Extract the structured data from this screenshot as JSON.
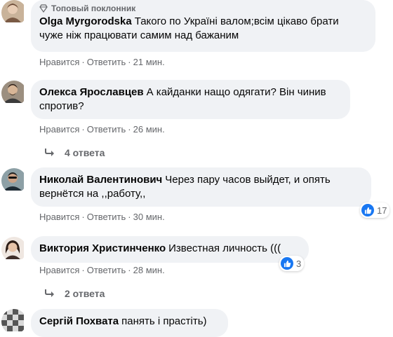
{
  "colors": {
    "bubble_bg": "#f0f2f5",
    "meta_text": "#65676b",
    "like_blue": "#1877f2"
  },
  "comments": [
    {
      "badge": "Топовый поклонник",
      "author": "Olga Myrgorodska",
      "text_line1": "Такого по Україні валом;всім цікаво брати",
      "text_line2": "чуже ніж працювати самим над бажаним",
      "like": "Нравится",
      "reply": "Ответить",
      "time": "21 мин."
    },
    {
      "author": "Олекса Ярославцев",
      "text_line1": "А кайданки нащо одягати? Він чинив",
      "text_line2": "спротив?",
      "like": "Нравится",
      "reply": "Ответить",
      "time": "26 мин.",
      "replies": "4 ответа"
    },
    {
      "author": "Николай Валентинович",
      "text_line1": "Через пару часов выйдет, и опять",
      "text_line2": "вернётся на ,,работу,,",
      "like": "Нравится",
      "reply": "Ответить",
      "time": "30 мин.",
      "reactions": "17"
    },
    {
      "author": "Виктория Христинченко",
      "text_line1": "Известная личность (((",
      "like": "Нравится",
      "reply": "Ответить",
      "time": "28 мин.",
      "reactions": "3",
      "replies": "2 ответа"
    },
    {
      "author": "Сергій Похвата",
      "text_line1": "панять і прастіть)"
    }
  ],
  "icons": {
    "badge": "diamond-icon",
    "reply_arrow": "reply-arrow-icon",
    "reaction": "thumbs-up-icon"
  }
}
